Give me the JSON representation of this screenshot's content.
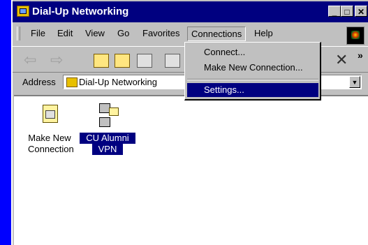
{
  "window": {
    "title": "Dial-Up Networking",
    "controls": {
      "minimize": "_",
      "maximize": "□",
      "close": "✕"
    }
  },
  "menubar": {
    "items": [
      {
        "label": "File"
      },
      {
        "label": "Edit"
      },
      {
        "label": "View"
      },
      {
        "label": "Go"
      },
      {
        "label": "Favorites"
      },
      {
        "label": "Connections"
      },
      {
        "label": "Help"
      }
    ]
  },
  "toolbar": {
    "back": "⇦",
    "forward": "⇨",
    "more": "»"
  },
  "address": {
    "label": "Address",
    "value": "Dial-Up Networking"
  },
  "connections_menu": {
    "items": [
      {
        "label": "Connect..."
      },
      {
        "label": "Make New Connection..."
      },
      {
        "label": "Settings..."
      }
    ]
  },
  "files": [
    {
      "line1": "Make New",
      "line2": "Connection",
      "icon": "make-new-connection-icon"
    },
    {
      "line1": "CU Alumni",
      "line2": "VPN",
      "icon": "dialup-connection-icon"
    }
  ],
  "colors": {
    "desktop": "#0000ff",
    "titlebar": "#000080",
    "highlight": "#000080",
    "face": "#c0c0c0"
  }
}
